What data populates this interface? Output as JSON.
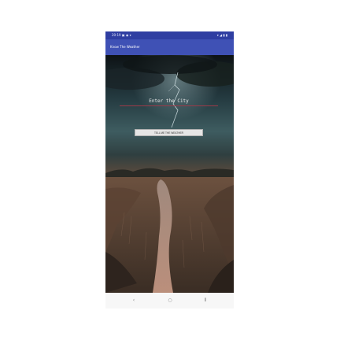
{
  "status_bar": {
    "left_text": "20:19 ▣ ◉ ▾",
    "right_text": "▾ ◢ ▮ ▮"
  },
  "app_bar": {
    "title": "Know The Weather"
  },
  "city_input": {
    "placeholder": "Enter the City",
    "value": ""
  },
  "tell_button": {
    "label": "TELL ME THE WEATHER"
  },
  "nav_bar": {
    "back_glyph": "‹",
    "home_glyph": "○",
    "recents_glyph": "⦀"
  },
  "colors": {
    "app_bar": "#3f51b5",
    "status_bar": "#2f3ea2",
    "input_underline": "#9b3a49",
    "button_bg": "#e5e5e5"
  }
}
